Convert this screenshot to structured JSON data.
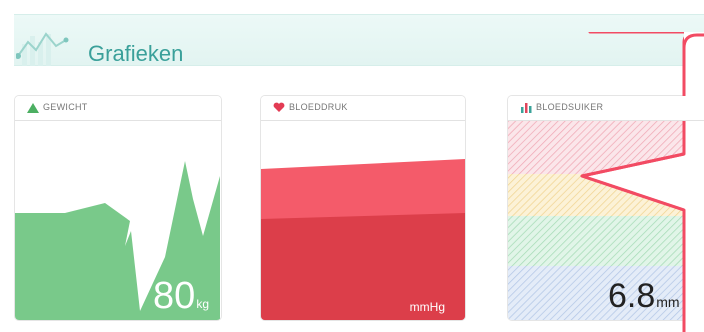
{
  "header": {
    "title": "Grafieken",
    "icon": "line-chart-icon"
  },
  "cards": {
    "weight": {
      "title": "GEWICHT",
      "icon": "mountain-icon",
      "value": "80",
      "unit": "kg",
      "color": "#79c98a"
    },
    "blood_pressure": {
      "title": "BLOEDDRUK",
      "icon": "heart-icon",
      "unit": "mmHg",
      "colors": {
        "upper": "#f45b6a",
        "lower": "#dc3e4a"
      }
    },
    "blood_sugar": {
      "title": "BLOEDSUIKER",
      "icon": "bar-chart-icon",
      "value": "6.8",
      "unit": "mm",
      "band_colors": [
        "#f6c7cf",
        "#f7e3ad",
        "#bfe8cc",
        "#c9d8f1"
      ]
    }
  },
  "callout": {
    "shape": "speech-bubble",
    "color": "#f24b63"
  }
}
